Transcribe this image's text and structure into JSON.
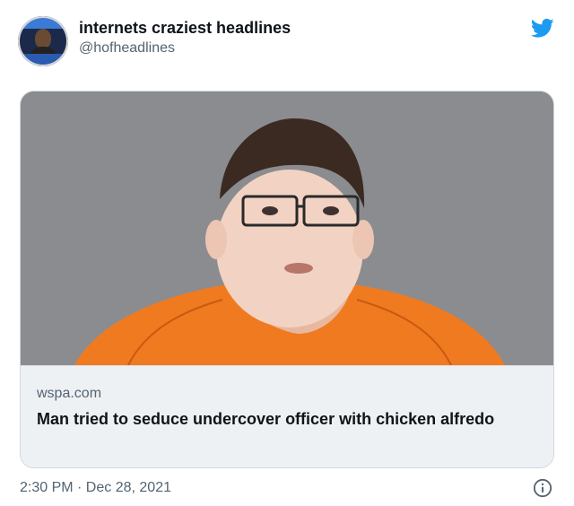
{
  "tweet": {
    "author_name": "internets craziest headlines",
    "author_handle": "@hofheadlines",
    "timestamp": "2:30 PM · Dec 28, 2021"
  },
  "card": {
    "domain": "wspa.com",
    "headline": "Man tried to seduce undercover officer with chicken alfredo"
  },
  "colors": {
    "twitter_blue": "#1d9bf0",
    "text_primary": "#0f1419",
    "text_secondary": "#536471"
  },
  "icons": [
    "twitter-bird-icon",
    "info-icon"
  ]
}
